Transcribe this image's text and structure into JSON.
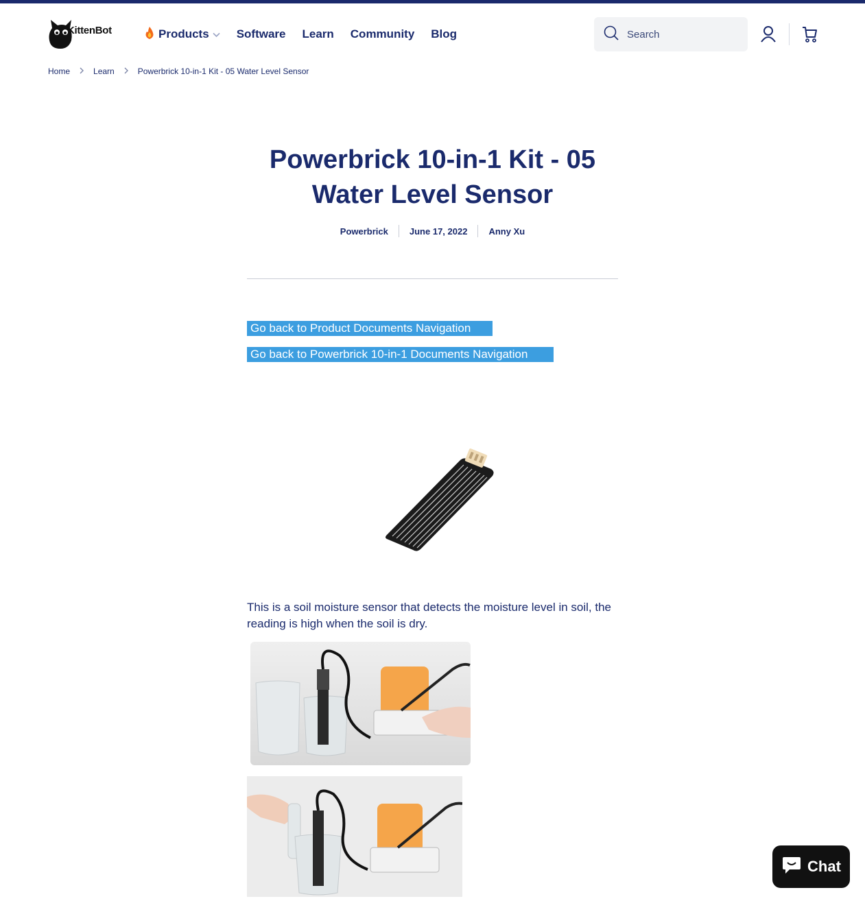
{
  "header": {
    "logo_text": "KittenBot",
    "nav": [
      {
        "label": "Products",
        "has_dropdown": true,
        "icon": "fire-icon"
      },
      {
        "label": "Software"
      },
      {
        "label": "Learn"
      },
      {
        "label": "Community"
      },
      {
        "label": "Blog"
      }
    ],
    "search_placeholder": "Search",
    "icons": [
      "search-icon",
      "account-icon",
      "cart-icon"
    ]
  },
  "breadcrumb": [
    "Home",
    "Learn",
    "Powerbrick 10-in-1 Kit - 05 Water Level Sensor"
  ],
  "article": {
    "title_line1": "Powerbrick 10-in-1 Kit - 05",
    "title_line2": "Water Level Sensor",
    "meta": {
      "category": "Powerbrick",
      "date": "June 17, 2022",
      "author": "Anny Xu"
    },
    "links": [
      "Go back to Product Documents Navigation",
      "Go back to Powerbrick 10-in-1 Documents Navigation"
    ],
    "paragraph": "This is a soil moisture sensor that detects the moisture level in soil, the reading is high when the soil is dry."
  },
  "chat": {
    "label": "Chat"
  },
  "colors": {
    "brand": "#1a2a6c",
    "highlight": "#3c9ee0",
    "chat_bg": "#111111"
  }
}
